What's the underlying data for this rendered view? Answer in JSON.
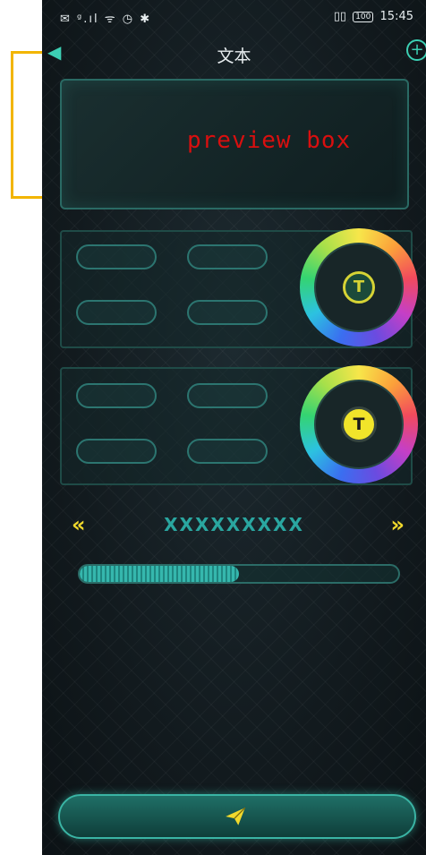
{
  "status_bar": {
    "left_icons": "✉ ᵍ.ıl ᯤ ◷ ✱",
    "battery": "100",
    "time": "15:45"
  },
  "header": {
    "title": "文本",
    "back_icon": "chevron-left-icon",
    "add_icon": "plus-circle-icon"
  },
  "preview": {
    "text": "preview box",
    "text_color": "#d90f0f",
    "highlight_color": "#f2b500"
  },
  "color_panels": [
    {
      "wheel_button_label": "T"
    },
    {
      "wheel_button_label": "T"
    }
  ],
  "text_nav": {
    "value": "XXXXXXXXX",
    "prev_icon": "double-chevron-left-icon",
    "next_icon": "double-chevron-right-icon"
  },
  "progress": {
    "fraction": 0.5
  },
  "send": {
    "icon": "paper-plane-icon"
  },
  "colors": {
    "accent": "#3ccfb3",
    "yellow": "#f1d92c"
  }
}
